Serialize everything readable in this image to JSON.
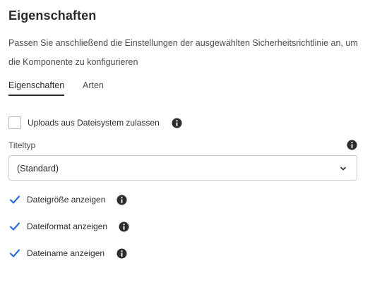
{
  "panel": {
    "title": "Eigenschaften",
    "description": "Passen Sie anschließend die Einstellungen der ausgewählten Sicherheitsrichtlinie an, um die Komponente zu konfigurieren"
  },
  "tabs": [
    {
      "label": "Eigenschaften",
      "selected": true
    },
    {
      "label": "Arten",
      "selected": false
    }
  ],
  "uploads_option": {
    "label": "Uploads aus Dateisystem zulassen",
    "checked": false,
    "icon": "info-icon"
  },
  "title_type": {
    "label": "Titeltyp",
    "icon": "info-icon",
    "selected_value": "(Standard)",
    "dropdown_icon": "chevron-down-icon"
  },
  "display_options": [
    {
      "label": "Dateigröße anzeigen",
      "checked": true,
      "icon": "info-icon"
    },
    {
      "label": "Dateiformat anzeigen",
      "checked": true,
      "icon": "info-icon"
    },
    {
      "label": "Dateiname anzeigen",
      "checked": true,
      "icon": "info-icon"
    }
  ],
  "colors": {
    "checkmark": "#2d6dd6",
    "text": "#2c2c2c",
    "border": "#c8c8c8"
  }
}
